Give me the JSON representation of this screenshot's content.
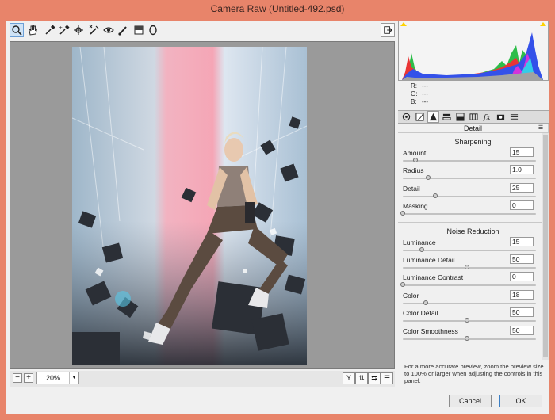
{
  "window": {
    "title": "Camera Raw (Untitled-492.psd)"
  },
  "toolbar": {
    "tools": [
      {
        "name": "zoom-tool",
        "icon": "magnifier-icon",
        "active": true
      },
      {
        "name": "hand-tool",
        "icon": "hand-icon"
      },
      {
        "name": "white-balance-tool",
        "icon": "eyedropper-icon"
      },
      {
        "name": "color-sampler-tool",
        "icon": "eyedropper-plus-icon"
      },
      {
        "name": "targeted-adjustment-tool",
        "icon": "target-adjust-icon"
      },
      {
        "name": "spot-removal-tool",
        "icon": "brush-x-icon"
      },
      {
        "name": "red-eye-tool",
        "icon": "eye-icon"
      },
      {
        "name": "adjustment-brush-tool",
        "icon": "brush-icon"
      },
      {
        "name": "graduated-filter-tool",
        "icon": "graduated-filter-icon"
      },
      {
        "name": "radial-filter-tool",
        "icon": "radial-filter-icon"
      }
    ],
    "open_preferences_icon": "export-icon"
  },
  "preview": {
    "zoom": "20%"
  },
  "info": {
    "r": {
      "label": "R:",
      "value": "---"
    },
    "g": {
      "label": "G:",
      "value": "---"
    },
    "b": {
      "label": "B:",
      "value": "---"
    }
  },
  "panel": {
    "title": "Detail",
    "sharpening_title": "Sharpening",
    "noise_title": "Noise Reduction",
    "sharpening": [
      {
        "label": "Amount",
        "value": "15",
        "level": 0.1
      },
      {
        "label": "Radius",
        "value": "1.0",
        "level": 0.2
      },
      {
        "label": "Detail",
        "value": "25",
        "level": 0.25
      },
      {
        "label": "Masking",
        "value": "0",
        "level": 0.0
      }
    ],
    "noise": [
      {
        "label": "Luminance",
        "value": "15",
        "level": 0.15
      },
      {
        "label": "Luminance Detail",
        "value": "50",
        "level": 0.5
      },
      {
        "label": "Luminance Contrast",
        "value": "0",
        "level": 0.0
      },
      {
        "label": "Color",
        "value": "18",
        "level": 0.18
      },
      {
        "label": "Color Detail",
        "value": "50",
        "level": 0.5
      },
      {
        "label": "Color Smoothness",
        "value": "50",
        "level": 0.5
      }
    ],
    "note": "For a more accurate preview, zoom the preview size to 100% or larger when adjusting the controls in this panel."
  },
  "buttons": {
    "cancel": "Cancel",
    "ok": "OK"
  },
  "colors": {
    "frame": "#e8846a",
    "accent": "#3c7fc4",
    "pink_band": "#f0a6b4"
  }
}
